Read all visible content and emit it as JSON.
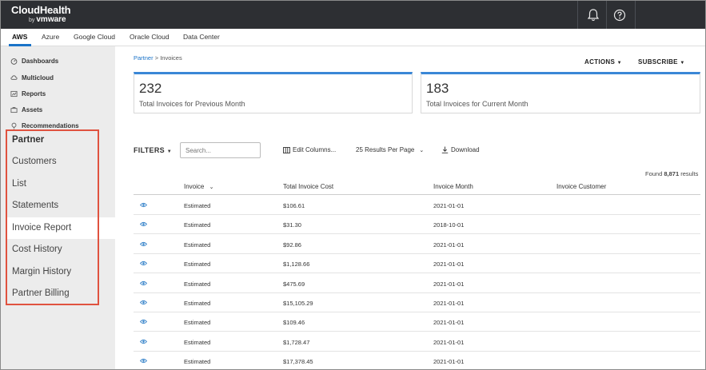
{
  "app": {
    "logo_text": "CloudHealth",
    "logo_by": "by",
    "logo_vendor": "vmware",
    "bell_icon": "bell-icon",
    "help_icon": "help-icon"
  },
  "cloud_tabs": [
    "AWS",
    "Azure",
    "Google Cloud",
    "Oracle Cloud",
    "Data Center"
  ],
  "sidebar": {
    "nav": [
      {
        "label": "Dashboards",
        "icon": "dashboard-icon"
      },
      {
        "label": "Multicloud",
        "icon": "multicloud-icon"
      },
      {
        "label": "Reports",
        "icon": "reports-icon"
      },
      {
        "label": "Assets",
        "icon": "assets-icon"
      },
      {
        "label": "Recommendations",
        "icon": "recommendations-icon"
      }
    ],
    "partner_heading": "Partner",
    "partner_items": [
      "Customers",
      "List",
      "Statements",
      "Invoice Report",
      "Cost History",
      "Margin History",
      "Partner Billing"
    ],
    "highlight_color": "#e0523f"
  },
  "breadcrumb": {
    "parent": "Partner",
    "separator": ">",
    "current": "Invoices"
  },
  "header_actions": {
    "actions": "ACTIONS",
    "subscribe": "SUBSCRIBE"
  },
  "cards": [
    {
      "value": "232",
      "label": "Total Invoices for Previous Month"
    },
    {
      "value": "183",
      "label": "Total Invoices for Current Month"
    }
  ],
  "toolbar": {
    "filters": "FILTERS",
    "search_placeholder": "Search...",
    "edit_columns": "Edit Columns...",
    "per_page": "25 Results Per Page",
    "download": "Download"
  },
  "results": {
    "prefix": "Found",
    "count": "8,871",
    "suffix": "results"
  },
  "table": {
    "columns": [
      "Invoice",
      "Total Invoice Cost",
      "Invoice Month",
      "Invoice Customer"
    ],
    "rows": [
      {
        "invoice": "Estimated",
        "cost": "$106.61",
        "month": "2021-01-01",
        "customer": ""
      },
      {
        "invoice": "Estimated",
        "cost": "$31.30",
        "month": "2018-10-01",
        "customer": ""
      },
      {
        "invoice": "Estimated",
        "cost": "$92.86",
        "month": "2021-01-01",
        "customer": ""
      },
      {
        "invoice": "Estimated",
        "cost": "$1,128.66",
        "month": "2021-01-01",
        "customer": ""
      },
      {
        "invoice": "Estimated",
        "cost": "$475.69",
        "month": "2021-01-01",
        "customer": ""
      },
      {
        "invoice": "Estimated",
        "cost": "$15,105.29",
        "month": "2021-01-01",
        "customer": ""
      },
      {
        "invoice": "Estimated",
        "cost": "$109.46",
        "month": "2021-01-01",
        "customer": ""
      },
      {
        "invoice": "Estimated",
        "cost": "$1,728.47",
        "month": "2021-01-01",
        "customer": ""
      },
      {
        "invoice": "Estimated",
        "cost": "$17,378.45",
        "month": "2021-01-01",
        "customer": ""
      }
    ]
  }
}
